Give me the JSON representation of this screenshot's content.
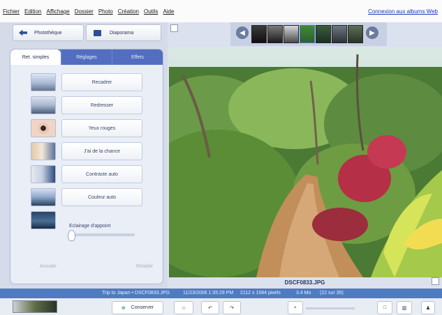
{
  "menu": {
    "items": [
      "Fichier",
      "Edition",
      "Affichage",
      "Dossier",
      "Photo",
      "Création",
      "Outils",
      "Aide"
    ],
    "link": "Connexion aux albums Web"
  },
  "nav": {
    "back_label": "Photothèque",
    "slideshow_label": "Diaporama"
  },
  "tabs": [
    "Ret. simples",
    "Réglages",
    "Effets"
  ],
  "tools": [
    "Recadrer",
    "Redresser",
    "Yeux rouges",
    "J'ai de la chance",
    "Contraste auto",
    "Couleur auto"
  ],
  "fill_light": {
    "label": "Eclairage d'appoint",
    "value": 0
  },
  "edit_buttons": {
    "undo": "Annuler",
    "redo": "Rétablir"
  },
  "photo": {
    "caption": "DSCF0833.JPG"
  },
  "status": {
    "album": "Trip to Japan • DSCF0833.JPG",
    "date": "11/23/2006 1:35:29 PM",
    "dimensions": "2112 x 1584 pixels",
    "size": "3.4 Mo",
    "position": "(22 sur 35)"
  },
  "toolbar": {
    "keep_label": "Conserver"
  },
  "colors": {
    "accent": "#4f7bc1",
    "tabbar": "#536ec0",
    "panel_bg": "#d5dbe8",
    "link": "#1d37b7"
  }
}
